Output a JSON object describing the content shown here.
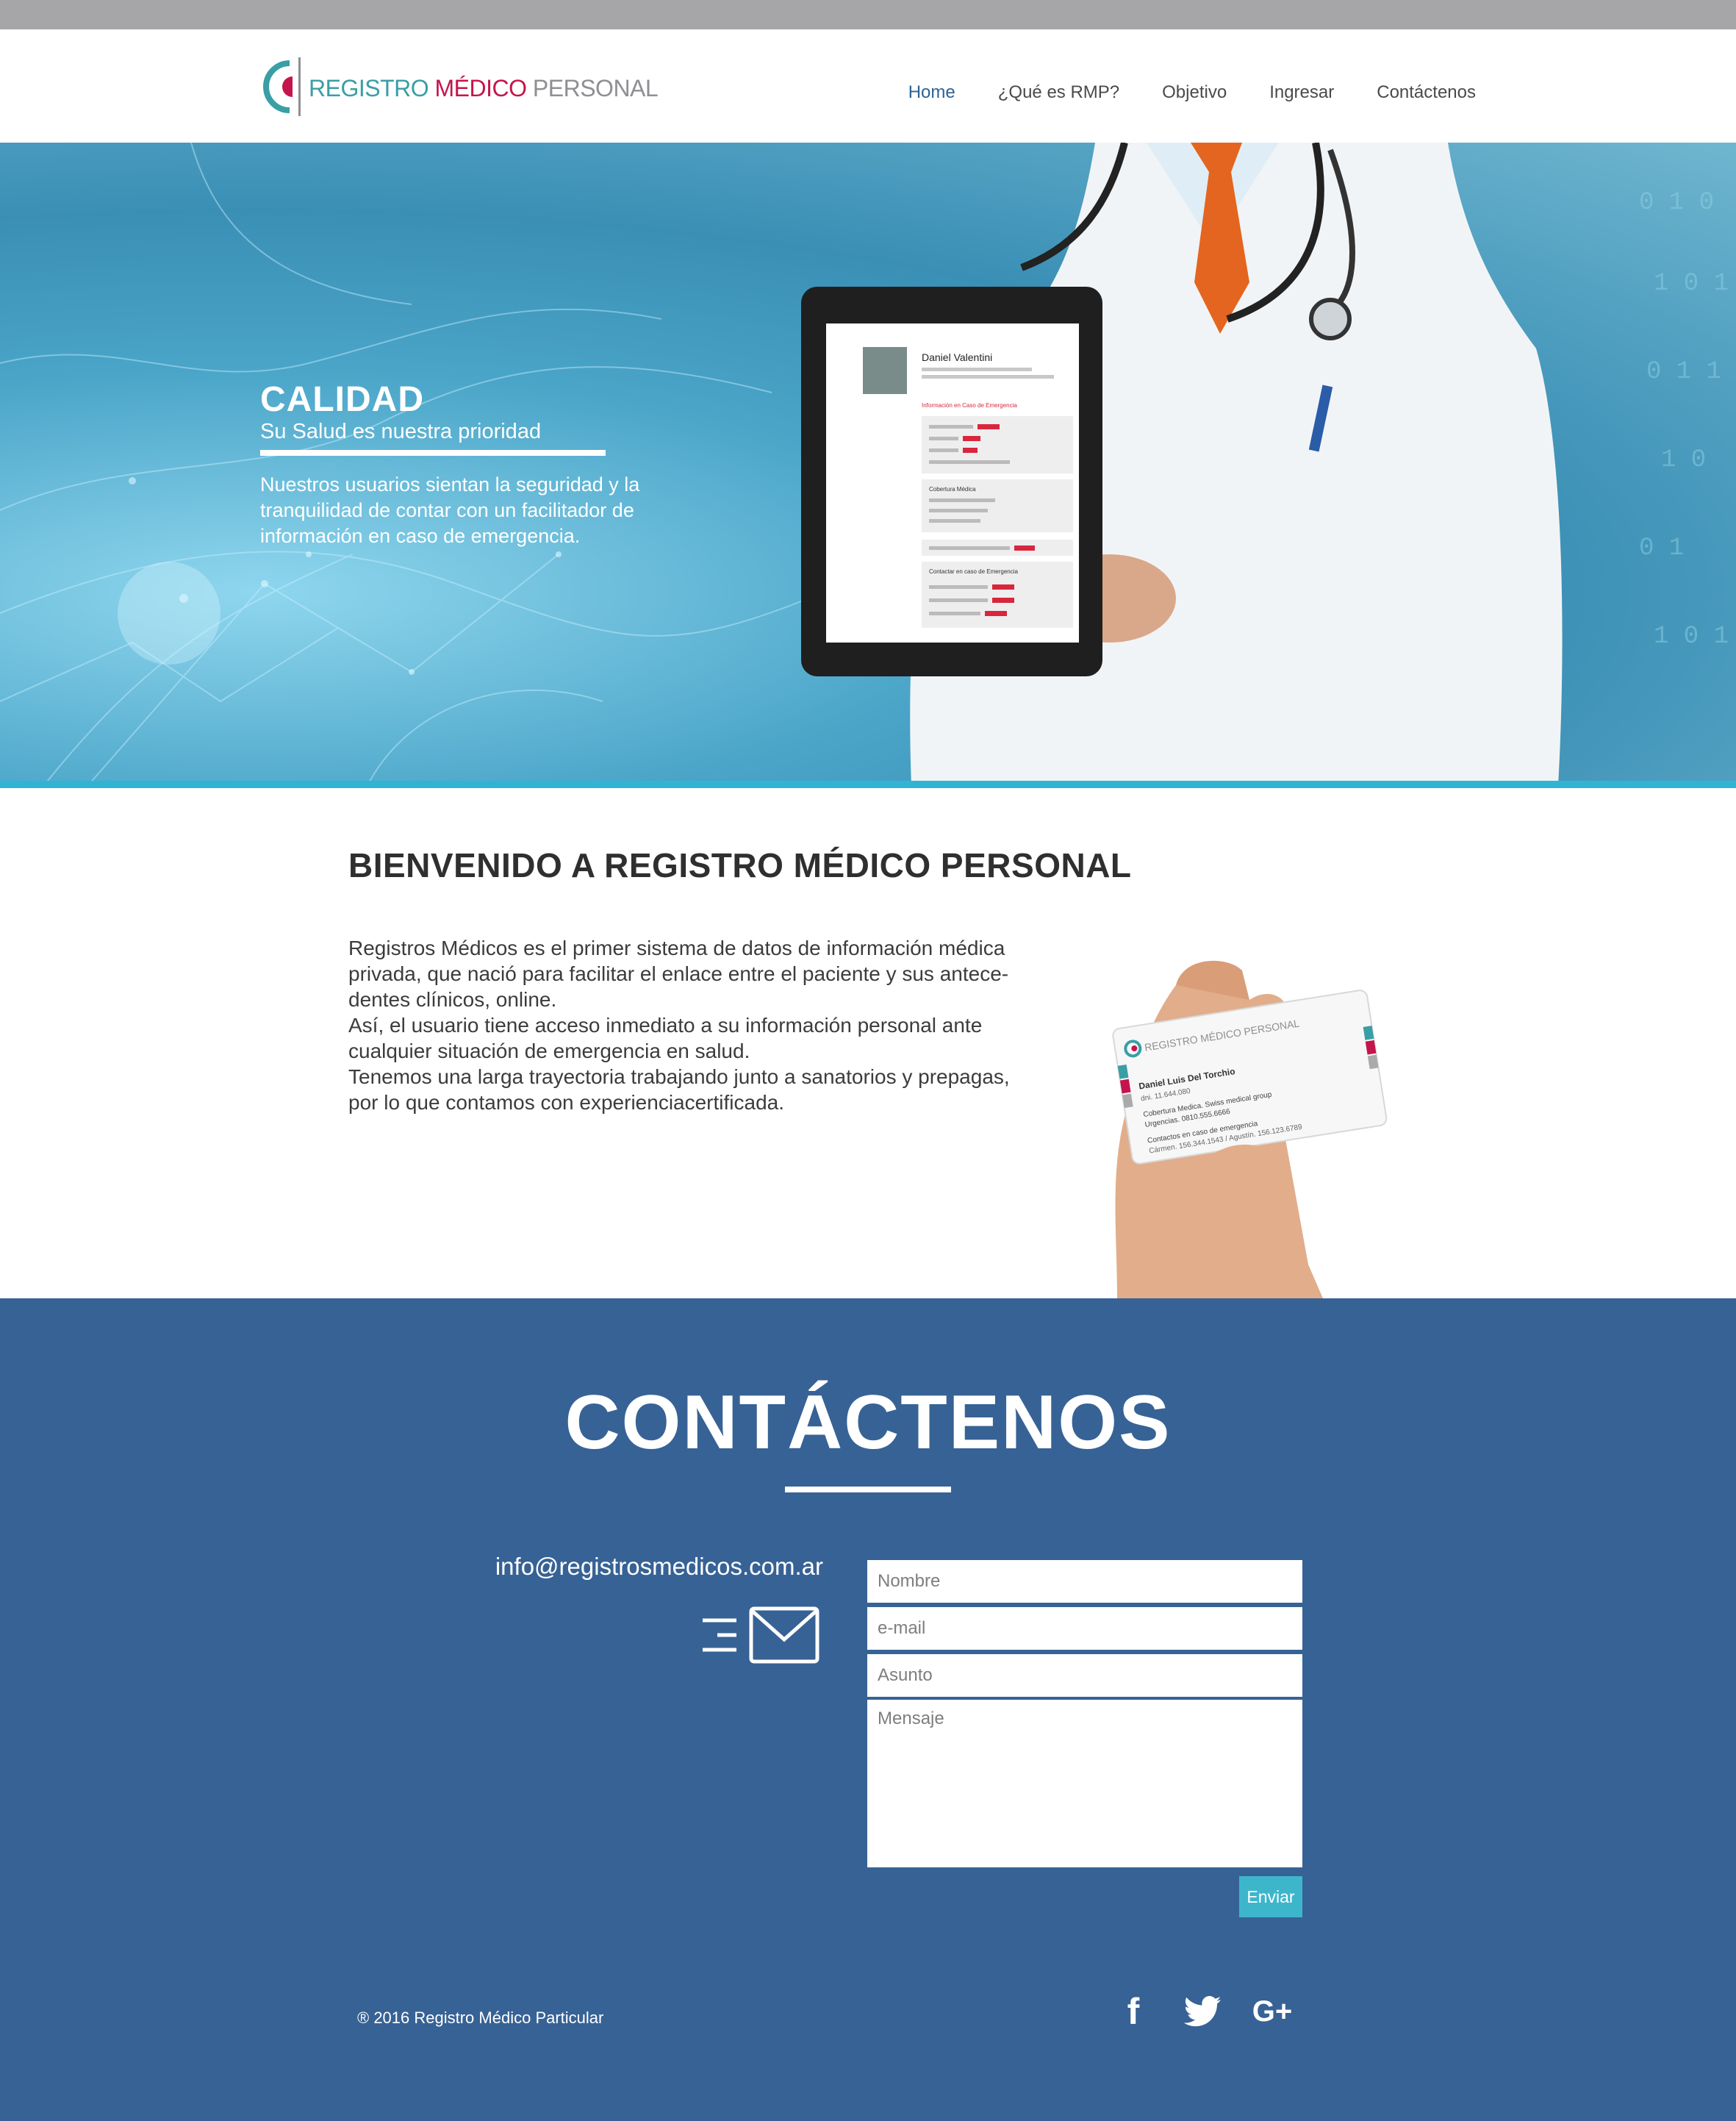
{
  "brand": {
    "part1": "REGISTRO",
    "part2": "MÉDICO",
    "part3": "PERSONAL",
    "colors": {
      "teal": "#3a9ea5",
      "crimson": "#c4154d",
      "grey": "#8f8f93"
    }
  },
  "nav": {
    "items": [
      {
        "label": "Home",
        "active": true
      },
      {
        "label": "¿Qué es RMP?"
      },
      {
        "label": "Objetivo"
      },
      {
        "label": "Ingresar"
      },
      {
        "label": "Contáctenos"
      }
    ]
  },
  "hero": {
    "title": "CALIDAD",
    "subtitle": "Su Salud es nuestra prioridad",
    "description": "Nuestros usuarios sientan la seguridad y la tranquilidad de contar con un facilitador de información en caso de emergencia.",
    "tablet": {
      "name": "Daniel Valentini",
      "emergency_heading": "Información en Caso de Emergencia",
      "coverage_heading": "Cobertura Médica",
      "contacts_heading": "Contactar en caso de Emergencia"
    }
  },
  "welcome": {
    "title": "BIENVENIDO A REGISTRO MÉDICO PERSONAL",
    "paragraphs": [
      "Registros Médicos es el primer sistema de datos de información médica privada, que nació para facilitar el enlace entre el paciente y sus antece- dentes clínicos, online.",
      "Así, el usuario tiene acceso inmediato a su información personal ante cualquier situación de emergencia en salud.",
      "Tenemos una larga trayectoria trabajando junto a sanatorios y prepagas, por lo que contamos con experienciacertificada."
    ],
    "card": {
      "brand": "REGISTRO MÉDICO PERSONAL",
      "name": "Daniel Luis Del Torchio",
      "dni": "dni. 11.644.080",
      "coverage": "Cobertura Medica. Swiss medical group",
      "urgencies": "Urgencias. 0810.555.6666",
      "contacts_heading": "Contactos en caso de emergencia",
      "contacts": "Cármen. 156.344.1543 / Agustín. 156.123.6789"
    }
  },
  "contact": {
    "title": "CONTÁCTENOS",
    "email": "info@registrosmedicos.com.ar",
    "form": {
      "name_placeholder": "Nombre",
      "email_placeholder": "e-mail",
      "subject_placeholder": "Asunto",
      "message_placeholder": "Mensaje",
      "submit_label": "Enviar"
    },
    "accent": "#3db6cc",
    "background": "#376295"
  },
  "footer": {
    "copyright": "® 2016 Registro Médico Particular",
    "social": [
      "facebook-icon",
      "twitter-icon",
      "google-plus-icon"
    ],
    "gplus_label": "G+"
  }
}
